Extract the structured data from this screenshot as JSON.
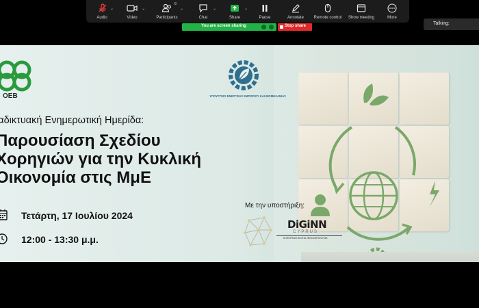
{
  "toolbar": {
    "audio_label": "Audio",
    "video_label": "Video",
    "participants_label": "Participants",
    "participants_count": "8",
    "chat_label": "Chat",
    "share_label": "Share",
    "pause_label": "Pause",
    "annotate_label": "Annotate",
    "remote_control_label": "Remote control",
    "show_meeting_label": "Show meeting",
    "more_label": "More"
  },
  "share_banner": {
    "status_text": "You are screen sharing",
    "stop_label": "Stop share",
    "status_color": "#22b347",
    "stop_color": "#e02929"
  },
  "talking_indicator": {
    "label": "Talking:"
  },
  "slide": {
    "org_logo_text": "OEB",
    "ministry_text": "ΥΠΟΥΡΓΕΙΟ ΕΝΕΡΓΕΙΑΣ ΕΜΠΟΡΙΟΥ ΚΑΙ ΒΙΟΜΗΧΑΝΙΑΣ",
    "subtitle": "ιαδικτυακή Ενημερωτική Ημερίδα:",
    "title_lines": [
      "Παρουσίαση Σχεδίου",
      "Χορηγιών για την Κυκλική",
      "Οικονομία στις ΜμΕ"
    ],
    "date": "Τετάρτη, 17 Ιουλίου 2024",
    "time": "12:00 - 13:30 μ.μ.",
    "support_label": "Με την υποστήριξη:",
    "sponsor_name": "DiGiNN",
    "sponsor_country": "CYPRUS",
    "sponsor_hub": "EUROPEAN DIGITAL INNOVATION HUB",
    "accent_green": "#2a9a3c",
    "circular_icon_green": "#7aa86a"
  }
}
